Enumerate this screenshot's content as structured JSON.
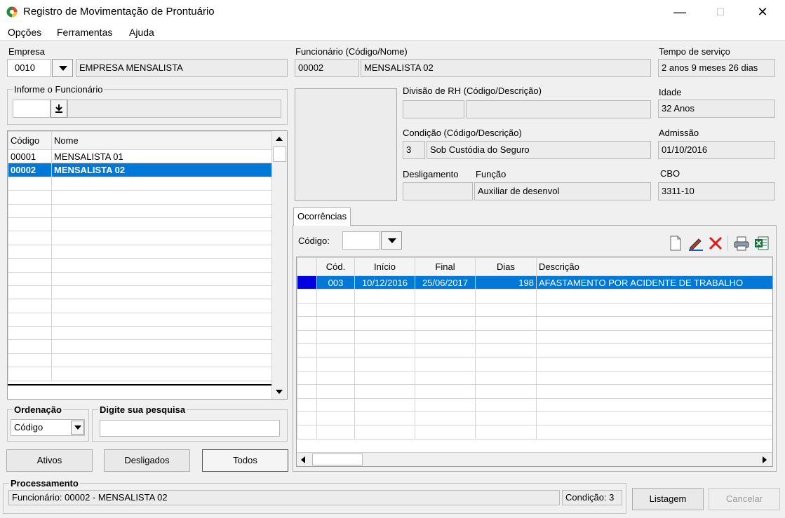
{
  "window": {
    "title": "Registro de Movimentação de Prontuário",
    "minimize": "—",
    "maximize": "☐",
    "close": "✕"
  },
  "menu": [
    "Opções",
    "Ferramentas",
    "Ajuda"
  ],
  "empresa": {
    "label": "Empresa",
    "code": "0010",
    "name": "EMPRESA MENSALISTA"
  },
  "informe": {
    "label": "Informe o Funcionário",
    "code": "",
    "name": ""
  },
  "list": {
    "columns": [
      "Código",
      "Nome"
    ],
    "rows": [
      {
        "code": "00001",
        "name": "MENSALISTA 01"
      },
      {
        "code": "00002",
        "name": "MENSALISTA 02"
      }
    ]
  },
  "ordenacao": {
    "label": "Ordenação",
    "value": "Código"
  },
  "pesquisa": {
    "label": "Digite sua pesquisa",
    "value": ""
  },
  "filters": {
    "ativos": "Ativos",
    "desligados": "Desligados",
    "todos": "Todos"
  },
  "funcionario": {
    "label": "Funcionário (Código/Nome)",
    "code": "00002",
    "name": "MENSALISTA 02"
  },
  "tempo": {
    "label": "Tempo de serviço",
    "value": "2 anos 9 meses 26 dias"
  },
  "divisao": {
    "label": "Divisão de RH (Código/Descrição)",
    "code": "",
    "desc": ""
  },
  "idade": {
    "label": "Idade",
    "value": "32 Anos"
  },
  "condicao": {
    "label": "Condição (Código/Descrição)",
    "code": "3",
    "desc": "Sob Custódia do Seguro"
  },
  "admissao": {
    "label": "Admissão",
    "value": "01/10/2016"
  },
  "desligamento": {
    "label": "Desligamento",
    "value": ""
  },
  "funcao": {
    "label": "Função",
    "value": "Auxiliar de desenvol"
  },
  "cbo": {
    "label": "CBO",
    "value": "3311-10"
  },
  "ocorrencias": {
    "tab": "Ocorrências",
    "codigo_label": "Código:",
    "codigo_value": "",
    "columns": [
      "Cód.",
      "Início",
      "Final",
      "Dias",
      "Descrição"
    ],
    "rows": [
      {
        "cod": "003",
        "inicio": "10/12/2016",
        "final": "25/06/2017",
        "dias": "198",
        "descricao": "AFASTAMENTO POR ACIDENTE DE TRABALHO"
      }
    ]
  },
  "processamento": {
    "label": "Processamento",
    "status": "Funcionário: 00002 - MENSALISTA 02",
    "condicao": "Condição: 3"
  },
  "actions": {
    "listagem": "Listagem",
    "cancelar": "Cancelar"
  }
}
